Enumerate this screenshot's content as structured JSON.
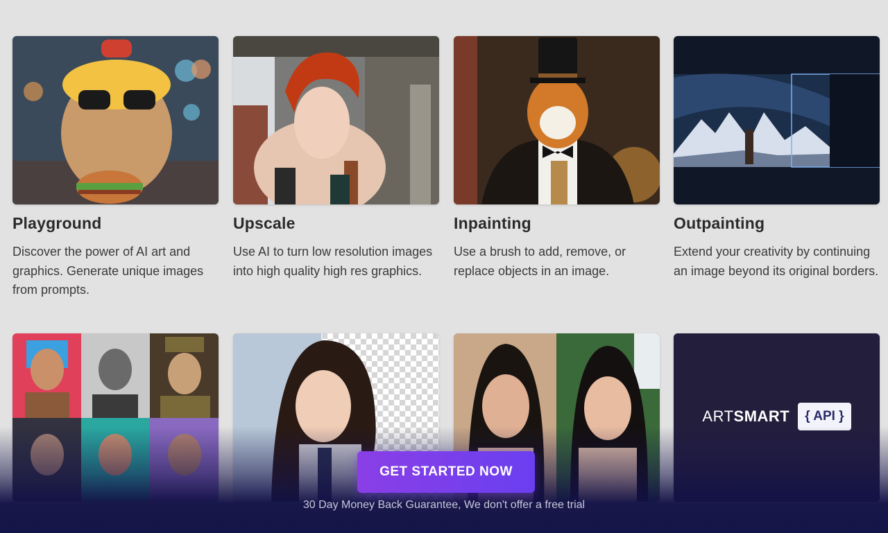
{
  "cards": [
    {
      "title": "Playground",
      "description": "Discover the power of AI art and graphics. Generate unique images from prompts."
    },
    {
      "title": "Upscale",
      "description": "Use AI to turn low resolution images into high quality high res graphics."
    },
    {
      "title": "Inpainting",
      "description": "Use a brush to add, remove, or replace objects in an image."
    },
    {
      "title": "Outpainting",
      "description": "Extend your creativity by continuing an image beyond its original borders."
    }
  ],
  "api_card": {
    "brand_light": "ART",
    "brand_bold": "SMART",
    "badge": "{ API }"
  },
  "cta": {
    "label": "GET STARTED NOW",
    "subtext": "30 Day Money Back Guarantee, We don't offer a free trial"
  },
  "colors": {
    "background": "#e2e2e2",
    "cta_start": "#8a3fe6",
    "cta_end": "#6a3ff0",
    "footer": "#141548"
  }
}
